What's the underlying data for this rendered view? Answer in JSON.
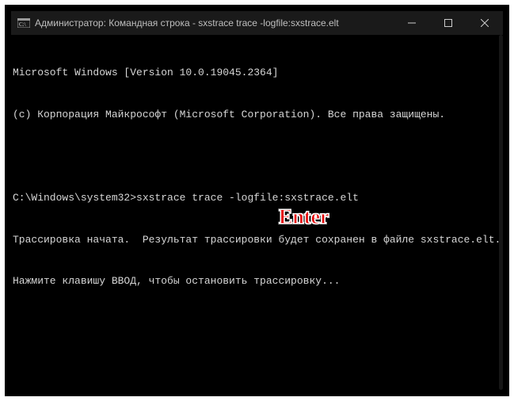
{
  "titlebar": {
    "title": "Администратор: Командная строка - sxstrace  trace -logfile:sxstrace.elt"
  },
  "terminal": {
    "line1": "Microsoft Windows [Version 10.0.19045.2364]",
    "line2": "(c) Корпорация Майкрософт (Microsoft Corporation). Все права защищены.",
    "promptPath": "C:\\Windows\\system32>",
    "command": "sxstrace trace -logfile:sxstrace.elt",
    "line4": "Трассировка начата.  Результат трассировки будет сохранен в файле sxstrace.elt.",
    "line5": "Нажмите клавишу ВВОД, чтобы остановить трассировку..."
  },
  "annotation": {
    "text": "Enter"
  }
}
